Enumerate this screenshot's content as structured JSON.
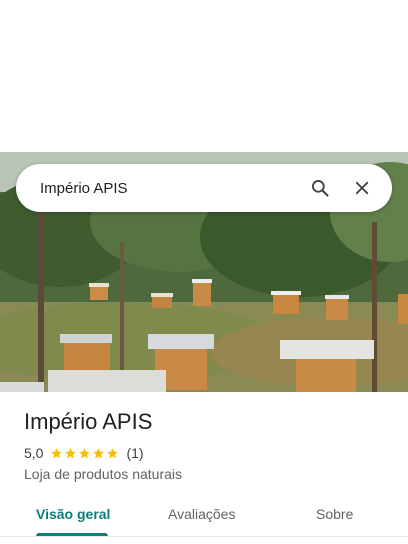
{
  "search": {
    "query": "Império APIS"
  },
  "place": {
    "name": "Império APIS",
    "rating": "5,0",
    "stars": 5,
    "review_count": "(1)",
    "category": "Loja de produtos naturais"
  },
  "tabs": [
    {
      "label": "Visão geral",
      "active": true
    },
    {
      "label": "Avaliações",
      "active": false
    },
    {
      "label": "Sobre",
      "active": false
    }
  ],
  "colors": {
    "accent": "#0b7e79",
    "star": "#fbbc04",
    "text": "#202124",
    "secondary": "#5f6368"
  },
  "icons": {
    "search": "search-icon",
    "close": "close-icon",
    "star": "star-icon"
  }
}
